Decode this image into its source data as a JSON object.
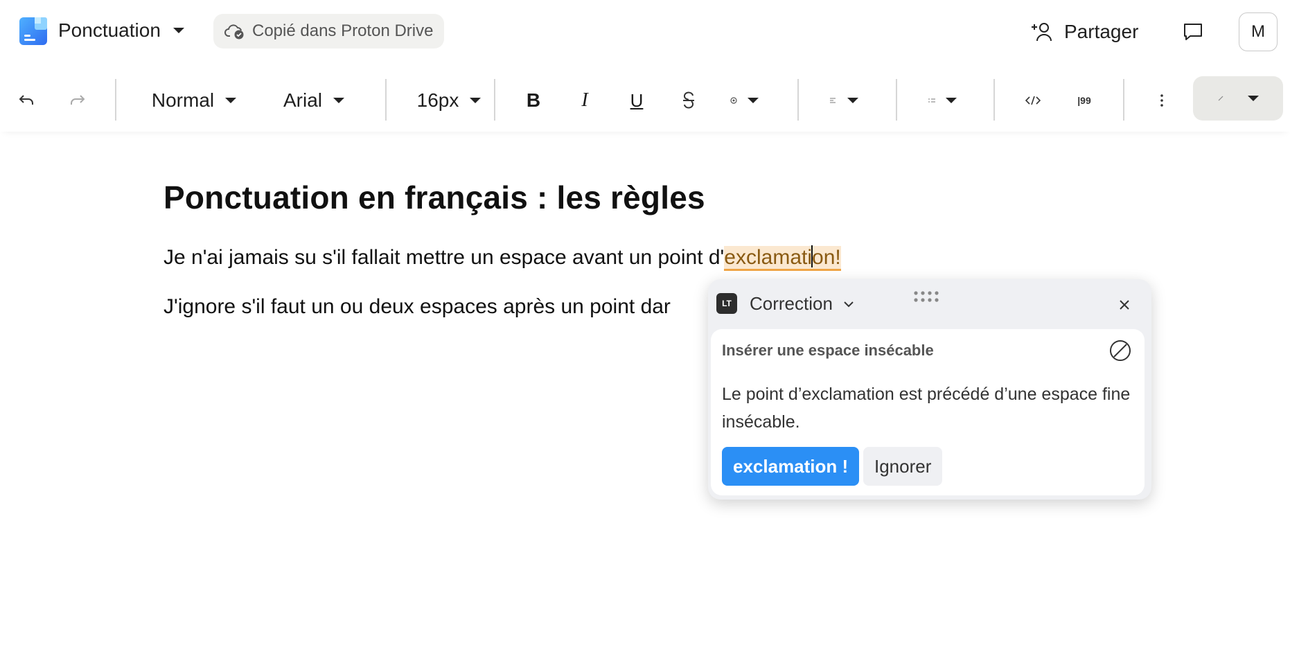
{
  "header": {
    "doc_title": "Ponctuation",
    "save_status": "Copié dans Proton Drive",
    "share_label": "Partager",
    "avatar_initial": "M"
  },
  "toolbar": {
    "block_style": "Normal",
    "font_family": "Arial",
    "font_size": "16px",
    "bold_glyph": "B",
    "italic_glyph": "I",
    "underline_glyph": "U",
    "quote_glyph": "|99"
  },
  "document": {
    "heading": "Ponctuation en français : les règles",
    "para1_before": "Je n'ai jamais su s'il fallait mettre un espace avant un point d'",
    "para1_mark_a": "exclamati",
    "para1_mark_b": "on!",
    "para2": "J'ignore s'il faut un ou deux espaces après un point dar"
  },
  "correction_popup": {
    "logo_text": "LT",
    "title": "Correction",
    "rule_title": "Insérer une espace insécable",
    "message": "Le point d’exclamation est précédé d’une espace fine insécable.",
    "suggestion": "exclamation !",
    "ignore_label": "Ignorer"
  },
  "colors": {
    "accent_blue": "#2b8ff5",
    "highlight_bg": "#fbe8d0",
    "highlight_underline": "#f0a546"
  },
  "icons": [
    "app-logo-icon",
    "cloud-check-icon",
    "user-plus-icon",
    "comment-icon",
    "undo-icon",
    "redo-icon",
    "strikethrough-icon",
    "link-icon",
    "align-left-icon",
    "list-icon",
    "code-icon",
    "more-vertical-icon",
    "highlighter-icon",
    "chevron-down-icon",
    "drag-handle-icon",
    "close-icon",
    "disable-rule-icon"
  ]
}
